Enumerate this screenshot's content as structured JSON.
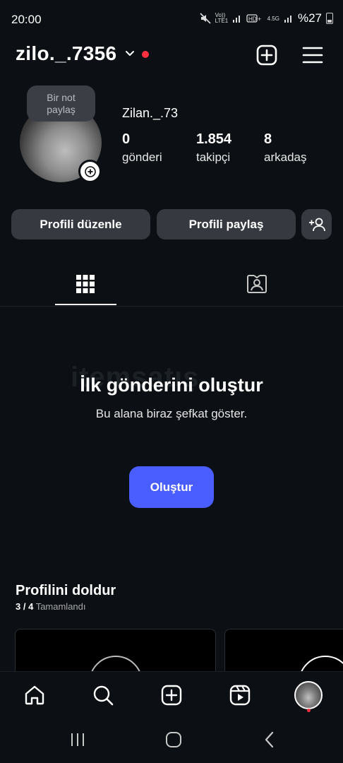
{
  "status_bar": {
    "time": "20:00",
    "network_labels": [
      "Vo)) LTE1",
      "4.5G"
    ],
    "battery_percent": "%27"
  },
  "header": {
    "username": "zilo._.7356",
    "icons": [
      "chevron-down-icon",
      "create-icon",
      "menu-icon"
    ],
    "notification_dot_color": "#ff3040"
  },
  "profile": {
    "note_line1": "Bir not",
    "note_line2": "paylaş",
    "display_name": "Zilan._.73",
    "stats": [
      {
        "value": "0",
        "label": "gönderi"
      },
      {
        "value": "1.854",
        "label": "takipçi"
      },
      {
        "value": "8",
        "label": "arkadaş"
      }
    ]
  },
  "actions": {
    "edit_label": "Profili düzenle",
    "share_label": "Profili paylaş",
    "discover_icon": "add-person-icon"
  },
  "tabs": [
    {
      "icon": "grid-icon",
      "active": true
    },
    {
      "icon": "tagged-icon",
      "active": false
    }
  ],
  "empty_state": {
    "watermark": "itemsatış",
    "title": "İlk gönderini oluştur",
    "subtitle": "Bu alana biraz şefkat göster.",
    "button": "Oluştur"
  },
  "complete_profile": {
    "title": "Profilini doldur",
    "progress_count": "3 / 4",
    "progress_label": "Tamamlandı"
  },
  "bottom_nav": [
    "home-icon",
    "search-icon",
    "create-icon",
    "reels-icon",
    "profile-avatar"
  ],
  "colors": {
    "background": "#0c1014",
    "button": "#363a40",
    "accent": "#4a5dff",
    "alert": "#ff3040"
  }
}
